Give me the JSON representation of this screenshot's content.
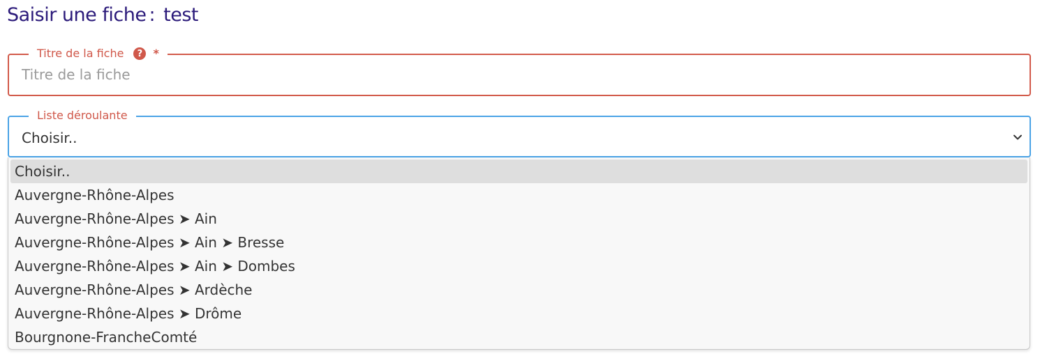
{
  "page": {
    "title_prefix": "Saisir une fiche",
    "title_separator": ":",
    "title_name": "test"
  },
  "title_field": {
    "legend": "Titre de la fiche",
    "help_icon": "question-circle-icon",
    "help_glyph": "?",
    "required_mark": "*",
    "placeholder": "Titre de la fiche",
    "value": ""
  },
  "select_field": {
    "legend": "Liste déroulante",
    "selected_value": "Choisir..",
    "chevron_icon": "chevron-down-icon",
    "options": [
      {
        "label": "Choisir..",
        "highlighted": true
      },
      {
        "label": "Auvergne-Rhône-Alpes"
      },
      {
        "label": "Auvergne-Rhône-Alpes ➤ Ain"
      },
      {
        "label": "Auvergne-Rhône-Alpes ➤ Ain ➤ Bresse"
      },
      {
        "label": "Auvergne-Rhône-Alpes ➤ Ain ➤ Dombes"
      },
      {
        "label": "Auvergne-Rhône-Alpes ➤ Ardèche"
      },
      {
        "label": "Auvergne-Rhône-Alpes ➤ Drôme"
      },
      {
        "label": "Bourgnone-FrancheComté"
      }
    ]
  },
  "colors": {
    "title": "#2b1a7a",
    "error_border": "#d25a4a",
    "focus_border": "#4aa3e6",
    "legend": "#d0584a",
    "highlight": "#dedede"
  }
}
